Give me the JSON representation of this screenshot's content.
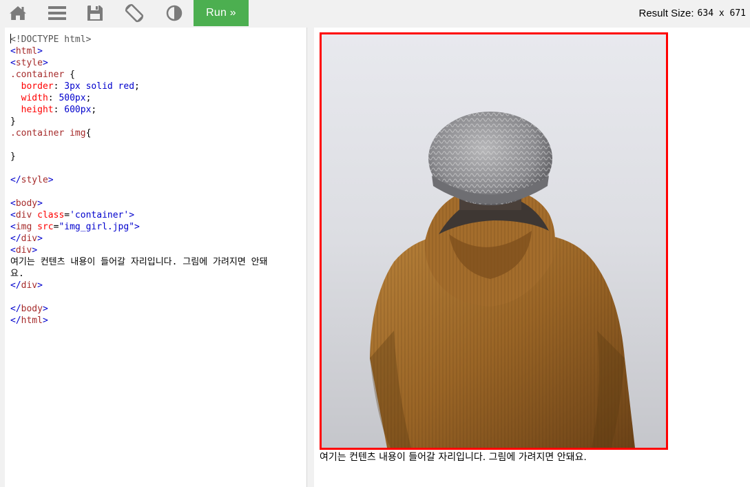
{
  "toolbar": {
    "icons": [
      "home-icon",
      "menu-icon",
      "save-icon",
      "rotate-icon",
      "contrast-icon"
    ],
    "run_label": "Run »",
    "result_size_label": "Result Size:",
    "result_size_value": "634 x 671"
  },
  "editor": {
    "lines": [
      "<!DOCTYPE html>",
      "<html>",
      "<style>",
      ".container {",
      "  border: 3px solid red;",
      "  width: 500px;",
      "  height: 600px;",
      "}",
      ".container img{",
      "",
      "}",
      "",
      "</style>",
      "",
      "<body>",
      "<div class='container'>",
      "<img src=\"img_girl.jpg\">",
      "</div>",
      "<div>",
      "여기는 컨텐츠 내용이 들어갈 자리입니다. 그림에 가려지면 안돼",
      "요.",
      "</div>",
      "",
      "</body>",
      "</html>"
    ]
  },
  "result": {
    "content_text": "여기는 컨텐츠 내용이 들어갈 자리입니다. 그림에 가려지면 안돼요.",
    "container_border_color": "#ff0000",
    "photo_subject": "person in knit beanie and brown corduroy hooded jacket, seen from behind"
  },
  "colors": {
    "run_button": "#4caf50",
    "toolbar_bg": "#f1f1f1",
    "toolbar_icons": "#7b7b7b"
  }
}
